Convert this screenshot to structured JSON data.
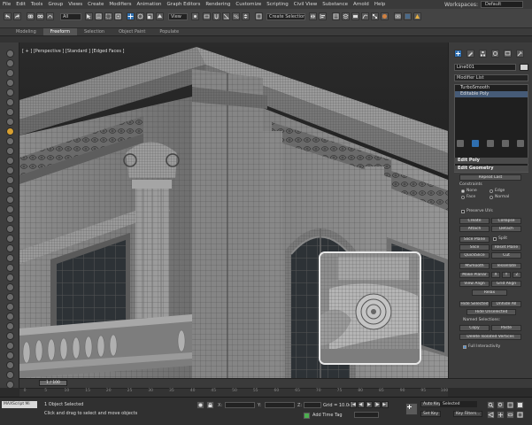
{
  "menu": {
    "items": [
      "File",
      "Edit",
      "Tools",
      "Group",
      "Views",
      "Create",
      "Modifiers",
      "Animation",
      "Graph Editors",
      "Rendering",
      "Customize",
      "Scripting",
      "Civil View",
      "Substance",
      "Arnold",
      "Help"
    ],
    "workspace_label": "Workspaces:",
    "workspace_value": "Default"
  },
  "toolbar": {
    "selection_filter": "All",
    "view_dropdown": "View",
    "selection_set": "Create Selection Se"
  },
  "ribbon": {
    "tabs": [
      "Modeling",
      "Freeform",
      "Selection",
      "Object Paint",
      "Populate"
    ],
    "active_tab": "Freeform"
  },
  "viewport": {
    "label": "[ + ] [Perspective ] [Standard ] [Edged Faces ]"
  },
  "command_panel": {
    "object_name": "Line001",
    "modifier_list": "Modifier List",
    "stack": [
      "TurboSmooth",
      "Editable Poly"
    ],
    "selected_stack_index": 1,
    "rollouts": {
      "edit_poly": "Edit Poly",
      "edit_geometry": "Edit Geometry"
    },
    "repeat_last": "Repeat Last",
    "constraints_label": "Constraints",
    "constraints": [
      "None",
      "Edge",
      "Face",
      "Normal"
    ],
    "preserve_uvs": "Preserve UVs",
    "buttons": {
      "create": "Create",
      "collapse": "Collapse",
      "attach": "Attach",
      "detach": "Detach",
      "slice_plane": "Slice Plane",
      "split": "Split",
      "slice": "Slice",
      "reset_plane": "Reset Plane",
      "quickslice": "QuickSlice",
      "cut": "Cut",
      "msmooth": "MSmooth",
      "tessellate": "Tessellate",
      "make_planar": "Make Planar",
      "x": "X",
      "y": "Y",
      "z": "Z",
      "view_align": "View Align",
      "grid_align": "Grid Align",
      "relax": "Relax",
      "hide_selected": "Hide Selected",
      "unhide_all": "Unhide All",
      "hide_unselected": "Hide Unselected",
      "copy": "Copy",
      "paste": "Paste",
      "delete_isolated": "Delete Isolated Vertices"
    },
    "named_selections": "Named Selections:",
    "full_interactivity": "Full Interactivity"
  },
  "timeline": {
    "slider_label": "1 / 100",
    "ruler_ticks": [
      "0",
      "5",
      "10",
      "15",
      "20",
      "25",
      "30",
      "35",
      "40",
      "45",
      "50",
      "55",
      "60",
      "65",
      "70",
      "75",
      "80",
      "85",
      "90",
      "95",
      "100"
    ]
  },
  "status": {
    "maxscript": "MAXScript Mi",
    "selection_info": "1 Object Selected",
    "prompt": "Click and drag to select and move objects",
    "x_label": "X:",
    "y_label": "Y:",
    "z_label": "Z:",
    "grid": "Grid = 10.0cm",
    "add_time_tag": "Add Time Tag",
    "auto_key": "Auto Key",
    "set_key": "Set Key",
    "selected": "Selected",
    "key_filters": "Key Filters..."
  }
}
